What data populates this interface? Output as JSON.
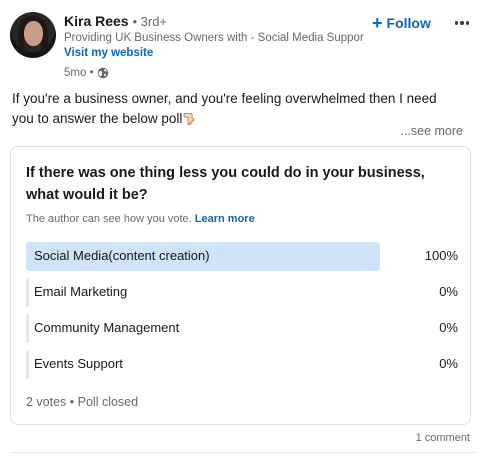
{
  "author": {
    "name": "Kira Rees",
    "degree": "• 3rd+",
    "headline": "Providing UK Business Owners with - Social Media Support, E...",
    "website_label": "Visit my website",
    "time": "5mo •",
    "visibility_icon": "globe-icon"
  },
  "actions": {
    "follow_label": "Follow",
    "follow_icon": "plus-icon",
    "more_icon": "ellipsis-icon"
  },
  "post": {
    "text": "If you're a business owner, and you're feeling overwhelmed then I need you to answer the below poll",
    "emoji_icon": "pointing-down-hand-icon",
    "see_more": "...see more"
  },
  "poll": {
    "question": "If there was one thing less you could do in your business, what would it be?",
    "author_note": "The author can see how you vote.",
    "learn_more": "Learn more",
    "options": [
      {
        "label": "Social Media(content creation)",
        "percent_text": "100%",
        "share": 1.0
      },
      {
        "label": "Email Marketing",
        "percent_text": "0%",
        "share": 0.0
      },
      {
        "label": "Community Management",
        "percent_text": "0%",
        "share": 0.0
      },
      {
        "label": "Events Support",
        "percent_text": "0%",
        "share": 0.0
      }
    ],
    "summary": "2 votes • Poll closed"
  },
  "social": {
    "comments": "1 comment"
  },
  "colors": {
    "link": "#0a66c2",
    "winner_fill": "#d0e3f8",
    "neutral_fill": "#e9e8e6"
  }
}
